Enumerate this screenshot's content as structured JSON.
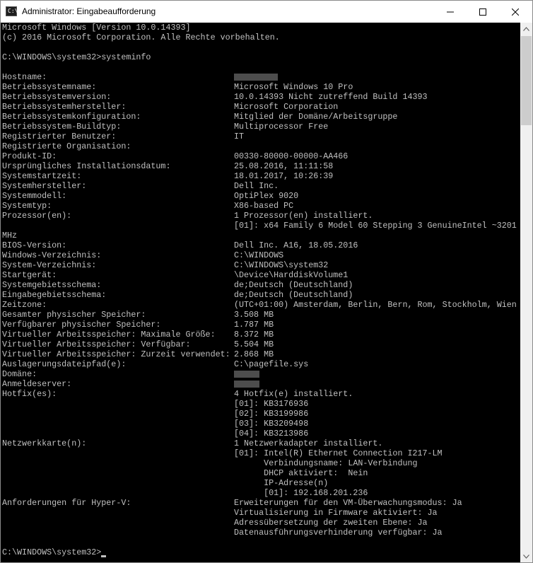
{
  "window": {
    "title": "Administrator: Eingabeaufforderung",
    "icon_label": "C:\\",
    "controls": [
      "minimize-icon",
      "maximize-icon",
      "close-icon"
    ]
  },
  "console": {
    "header": [
      "Microsoft Windows [Version 10.0.14393]",
      "(c) 2016 Microsoft Corporation. Alle Rechte vorbehalten."
    ],
    "command_line": "C:\\WINDOWS\\system32>systeminfo",
    "rows": [
      {
        "key": "Hostname:",
        "value": "",
        "redacted": true
      },
      {
        "key": "Betriebssystemname:",
        "value": "Microsoft Windows 10 Pro"
      },
      {
        "key": "Betriebssystemversion:",
        "value": "10.0.14393 Nicht zutreffend Build 14393"
      },
      {
        "key": "Betriebssystemhersteller:",
        "value": "Microsoft Corporation"
      },
      {
        "key": "Betriebssystemkonfiguration:",
        "value": "Mitglied der Domäne/Arbeitsgruppe"
      },
      {
        "key": "Betriebssystem-Buildtyp:",
        "value": "Multiprocessor Free"
      },
      {
        "key": "Registrierter Benutzer:",
        "value": "IT"
      },
      {
        "key": "Registrierte Organisation:",
        "value": ""
      },
      {
        "key": "Produkt-ID:",
        "value": "00330-80000-00000-AA466"
      },
      {
        "key": "Ursprüngliches Installationsdatum:",
        "value": "25.08.2016, 11:11:58"
      },
      {
        "key": "Systemstartzeit:",
        "value": "18.01.2017, 10:26:39"
      },
      {
        "key": "Systemhersteller:",
        "value": "Dell Inc."
      },
      {
        "key": "Systemmodell:",
        "value": "OptiPlex 9020"
      },
      {
        "key": "Systemtyp:",
        "value": "X86-based PC"
      },
      {
        "key": "Prozessor(en):",
        "value": "1 Prozessor(en) installiert."
      },
      {
        "key": "",
        "value": "[01]: x64 Family 6 Model 60 Stepping 3 GenuineIntel ~3201"
      },
      {
        "key": "MHz",
        "value": ""
      },
      {
        "key": "BIOS-Version:",
        "value": "Dell Inc. A16, 18.05.2016"
      },
      {
        "key": "Windows-Verzeichnis:",
        "value": "C:\\WINDOWS"
      },
      {
        "key": "System-Verzeichnis:",
        "value": "C:\\WINDOWS\\system32"
      },
      {
        "key": "Startgerät:",
        "value": "\\Device\\HarddiskVolume1"
      },
      {
        "key": "Systemgebietsschema:",
        "value": "de;Deutsch (Deutschland)"
      },
      {
        "key": "Eingabegebietsschema:",
        "value": "de;Deutsch (Deutschland)"
      },
      {
        "key": "Zeitzone:",
        "value": "(UTC+01:00) Amsterdam, Berlin, Bern, Rom, Stockholm, Wien"
      },
      {
        "key": "Gesamter physischer Speicher:",
        "value": "3.508 MB"
      },
      {
        "key": "Verfügbarer physischer Speicher:",
        "value": "1.787 MB"
      },
      {
        "key": "Virtueller Arbeitsspeicher: Maximale Größe:",
        "value": "8.372 MB"
      },
      {
        "key": "Virtueller Arbeitsspeicher: Verfügbar:",
        "value": "5.504 MB"
      },
      {
        "key": "Virtueller Arbeitsspeicher: Zurzeit verwendet:",
        "value": "2.868 MB"
      },
      {
        "key": "Auslagerungsdateipfad(e):",
        "value": "C:\\pagefile.sys"
      },
      {
        "key": "Domäne:",
        "value": "",
        "redacted": true
      },
      {
        "key": "Anmeldeserver:",
        "value": "",
        "redacted": true
      },
      {
        "key": "Hotfix(es):",
        "value": "4 Hotfix(e) installiert."
      },
      {
        "key": "",
        "value": "[01]: KB3176936"
      },
      {
        "key": "",
        "value": "[02]: KB3199986"
      },
      {
        "key": "",
        "value": "[03]: KB3209498"
      },
      {
        "key": "",
        "value": "[04]: KB3213986"
      },
      {
        "key": "Netzwerkkarte(n):",
        "value": "1 Netzwerkadapter installiert."
      },
      {
        "key": "",
        "value": "[01]: Intel(R) Ethernet Connection I217-LM"
      },
      {
        "key": "",
        "value": "      Verbindungsname: LAN-Verbindung"
      },
      {
        "key": "",
        "value": "      DHCP aktiviert:  Nein"
      },
      {
        "key": "",
        "value": "      IP-Adresse(n)"
      },
      {
        "key": "",
        "value": "      [01]: 192.168.201.236"
      },
      {
        "key": "Anforderungen für Hyper-V:",
        "value": "Erweiterungen für den VM-Überwachungsmodus: Ja"
      },
      {
        "key": "",
        "value": "Virtualisierung in Firmware aktiviert: Ja"
      },
      {
        "key": "",
        "value": "Adressübersetzung der zweiten Ebene: Ja"
      },
      {
        "key": "",
        "value": "Datenausführungsverhinderung verfügbar: Ja"
      }
    ],
    "prompt": "C:\\WINDOWS\\system32>"
  },
  "colors": {
    "console_bg": "#000000",
    "console_fg": "#c0c0c0",
    "titlebar_bg": "#ffffff"
  }
}
